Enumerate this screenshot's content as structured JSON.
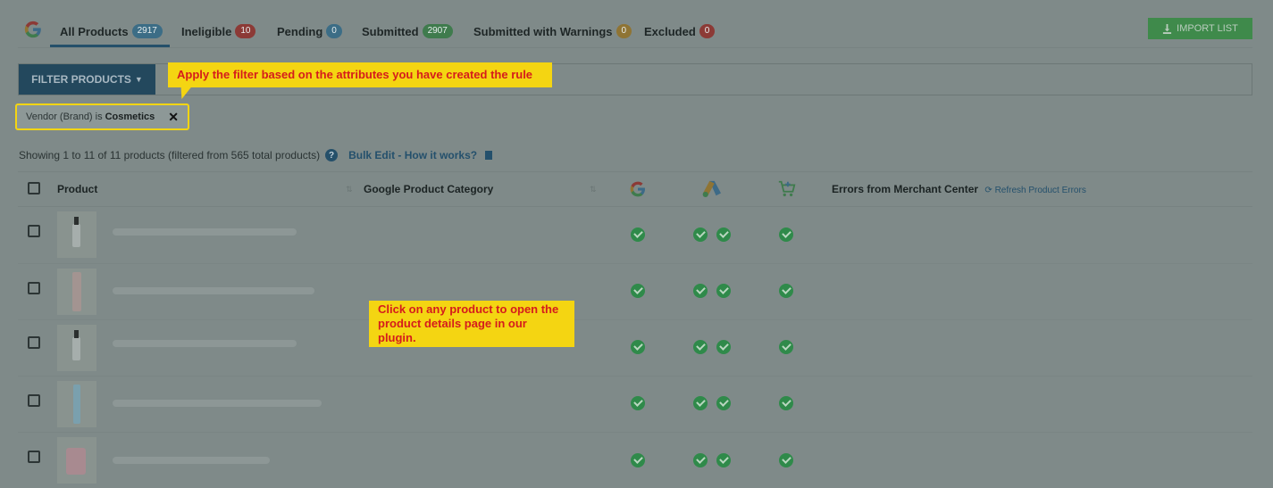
{
  "tabs": [
    {
      "label": "All Products",
      "count": "2917",
      "color": "#3c6d86"
    },
    {
      "label": "Ineligible",
      "count": "10",
      "color": "#8c3a36"
    },
    {
      "label": "Pending",
      "count": "0",
      "color": "#3c6d86"
    },
    {
      "label": "Submitted",
      "count": "2907",
      "color": "#3f7b4d"
    },
    {
      "label": "Submitted with Warnings",
      "count": "0",
      "color": "#8f7434"
    },
    {
      "label": "Excluded",
      "count": "0",
      "color": "#8c3a36"
    }
  ],
  "import_button": {
    "label": "IMPORT LIST",
    "icon": "download-icon"
  },
  "filter": {
    "button_label": "FILTER PRODUCTS",
    "chip_prefix": "Vendor (Brand) is",
    "chip_value": "Cosmetics",
    "chip_close": "✕"
  },
  "callouts": {
    "filter": "Apply the filter based on the attributes you have created the rule",
    "product": "Click on any product to open the product details page in our plugin."
  },
  "summary": {
    "showing": "Showing 1 to 11 of 11 products (filtered from 565 total products)",
    "help": "?",
    "bulk_edit": "Bulk Edit - How it works?"
  },
  "table": {
    "headers": {
      "product": "Product",
      "category": "Google Product Category",
      "errors": "Errors from Merchant Center",
      "refresh": "Refresh Product Errors"
    },
    "channel_icons": [
      "google-icon",
      "google-ads-icon",
      "shopping-cart-icon"
    ],
    "rows": [
      {
        "thumb": "bottle-pump",
        "status": {
          "google": true,
          "ads": [
            true,
            true
          ],
          "shopping": true
        }
      },
      {
        "thumb": "tube-pink",
        "status": {
          "google": true,
          "ads": [
            true,
            true
          ],
          "shopping": true
        }
      },
      {
        "thumb": "bottle-pump",
        "status": {
          "google": true,
          "ads": [
            true,
            true
          ],
          "shopping": true
        }
      },
      {
        "thumb": "tube-blue",
        "status": {
          "google": true,
          "ads": [
            true,
            true
          ],
          "shopping": true
        }
      },
      {
        "thumb": "jar-pink",
        "status": {
          "google": true,
          "ads": [
            true,
            true
          ],
          "shopping": true
        }
      }
    ]
  },
  "colors": {
    "accent": "#23485d",
    "callout": "#f4d512",
    "callout_text": "#d51c1c",
    "success": "#2f8a4a"
  }
}
